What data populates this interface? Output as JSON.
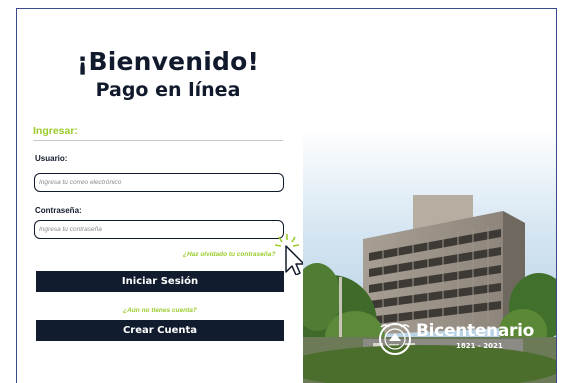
{
  "header": {
    "title": "¡Bienvenido!",
    "subtitle": "Pago en línea"
  },
  "form": {
    "section_label": "Ingresar:",
    "user_label": "Usuario:",
    "user_placeholder": "Ingresa tu correo electrónico",
    "user_value": "",
    "password_label": "Contraseña:",
    "password_placeholder": "Ingresa tu contraseña",
    "password_value": "",
    "forgot_link": "¿Haz olvidado tu contraseña?",
    "login_button": "Iniciar Sesión",
    "no_account_text": "¿Aún no tienes cuenta?",
    "create_button": "Crear Cuenta"
  },
  "branding": {
    "logo_text": "Bicentenario",
    "logo_years": "1821 - 2021",
    "seal_icon": "university-seal-icon"
  },
  "colors": {
    "navy": "#111c2e",
    "accent_green": "#9ccb2c",
    "frame_border": "#3a4a8a"
  },
  "cursor": {
    "icon": "pointer-cursor-icon"
  }
}
